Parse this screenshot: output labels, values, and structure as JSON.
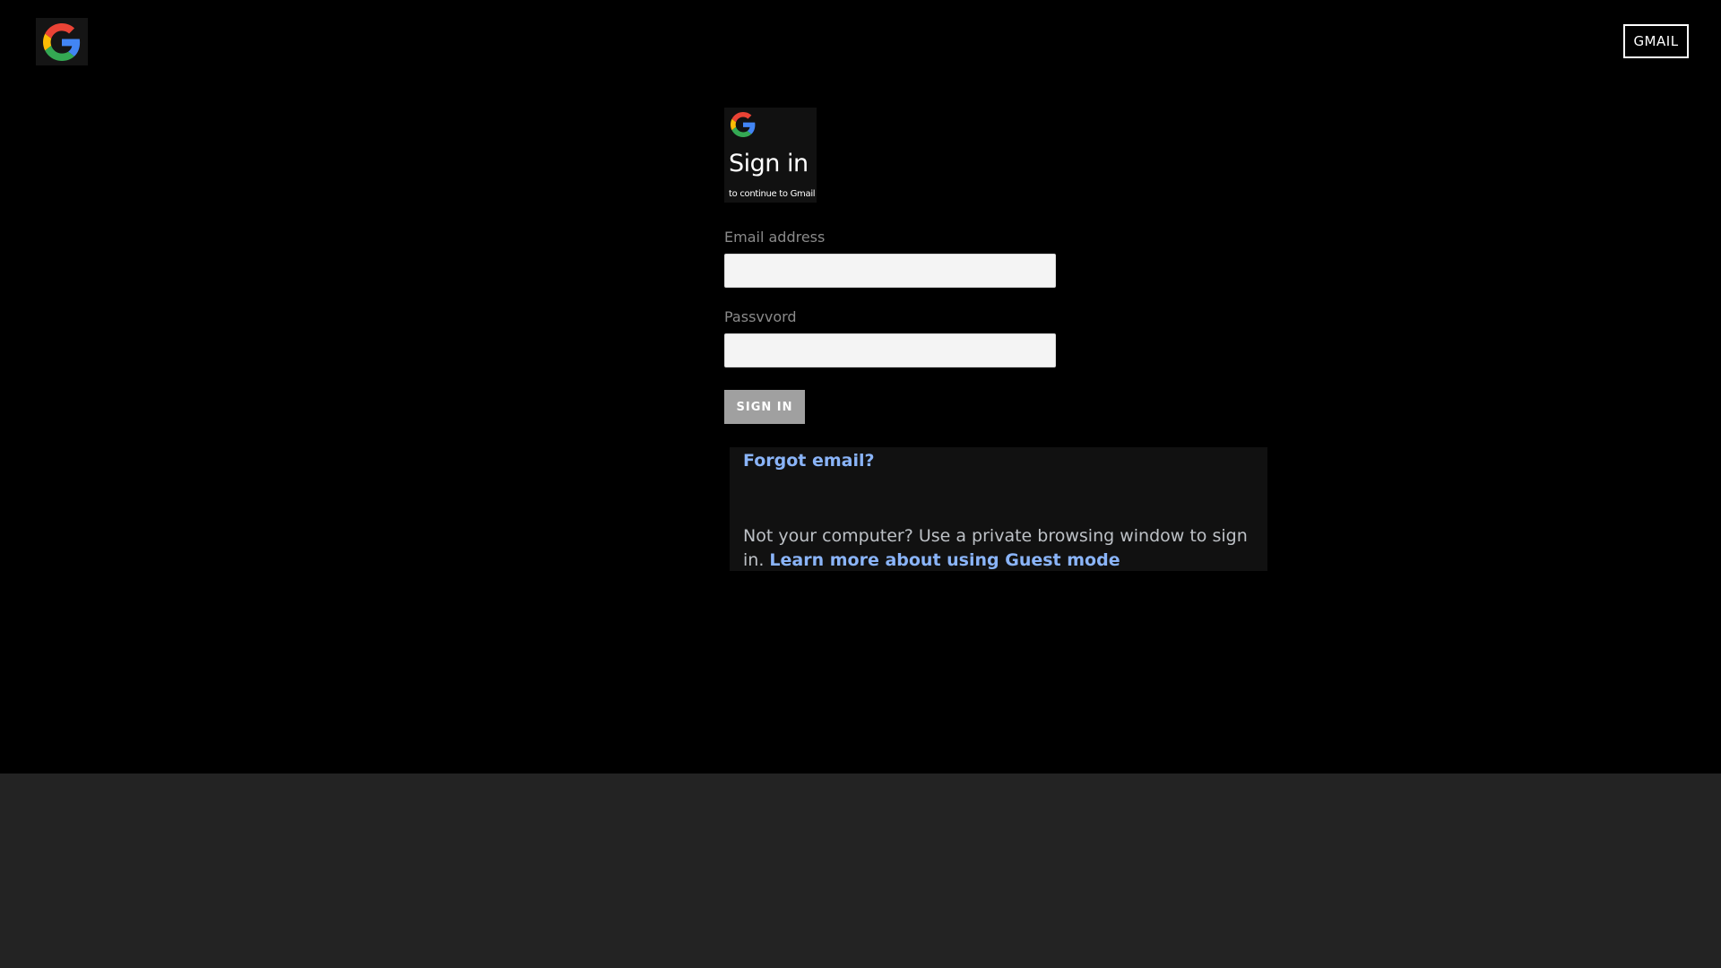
{
  "header": {
    "gmail_button_label": "GMAIL"
  },
  "signin_card": {
    "title": "Sign in",
    "subtitle": "to continue to Gmail"
  },
  "form": {
    "email_label": "Email address",
    "email_value": "",
    "password_label": "Passvvord",
    "password_value": "",
    "submit_label": "SIGN IN"
  },
  "help": {
    "forgot_email": "Forgot email?",
    "notice_text": "Not your computer? Use a private browsing window to sign in. ",
    "learn_more": "Learn more about using Guest mode"
  },
  "icons": {
    "brand_logo": "google-g-icon"
  },
  "colors": {
    "background": "#000000",
    "footer_band": "#232323",
    "link": "#8ab4f8",
    "button": "#a0a0a0",
    "google_blue": "#4285F4",
    "google_red": "#EA4335",
    "google_yellow": "#FBBC05",
    "google_green": "#34A853"
  }
}
